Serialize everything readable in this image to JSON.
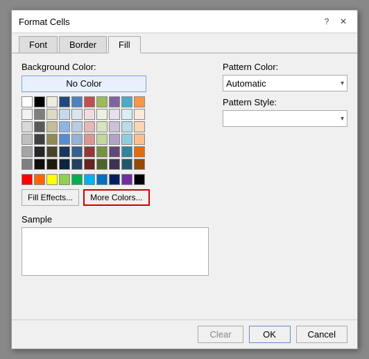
{
  "dialog": {
    "title": "Format Cells",
    "tabs": [
      "Font",
      "Border",
      "Fill"
    ],
    "active_tab": "Fill"
  },
  "fill_tab": {
    "background_color_label": "Background Color:",
    "no_color_button": "No Color",
    "pattern_color_label": "Pattern Color:",
    "pattern_color_value": "Automatic",
    "pattern_style_label": "Pattern Style:",
    "pattern_style_value": "",
    "fill_effects_label": "Fill Effects...",
    "more_colors_label": "More Colors...",
    "sample_label": "Sample"
  },
  "footer": {
    "clear_label": "Clear",
    "ok_label": "OK",
    "cancel_label": "Cancel"
  },
  "color_rows": [
    [
      "#ffffff",
      "#000000",
      "#ff0000",
      "#ff0000",
      "#003366",
      "#003399",
      "#003399",
      "#000080",
      "#660066",
      "#800000"
    ],
    [
      "#f2f2f2",
      "#7f7f7f",
      "#ddd9c3",
      "#c6efce",
      "#daeef3",
      "#dce6f1",
      "#ebf1de",
      "#fde9d9",
      "#e6b8a2",
      "#d9d9d9"
    ],
    [
      "#d9d9d9",
      "#595959",
      "#c4bd97",
      "#9bbf85",
      "#b7dee8",
      "#b8cce4",
      "#d8e4bc",
      "#fcd5b4",
      "#d6704d",
      "#bfbfbf"
    ],
    [
      "#bfbfbf",
      "#404040",
      "#938953",
      "#75923c",
      "#31849b",
      "#4f81bd",
      "#9bbb59",
      "#f79646",
      "#c0504d",
      "#a5a5a5"
    ],
    [
      "#a5a5a5",
      "#262626",
      "#494429",
      "#375623",
      "#17375e",
      "#17375e",
      "#4f6228",
      "#974706",
      "#96251a",
      "#7f7f7f"
    ],
    [
      "#ff0000",
      "#ffff00",
      "#92d050",
      "#00b0f0",
      "#0070c0",
      "#002060",
      "#7030a0",
      "#000000",
      "#000000",
      "#000000"
    ],
    [
      "#ff0000",
      "#ffc000",
      "#ffff00",
      "#92d050",
      "#00b050",
      "#00b0f0",
      "#0070c0",
      "#002060",
      "#7030a0",
      "#000000"
    ]
  ],
  "title_bar_icons": {
    "help": "?",
    "close": "✕"
  }
}
